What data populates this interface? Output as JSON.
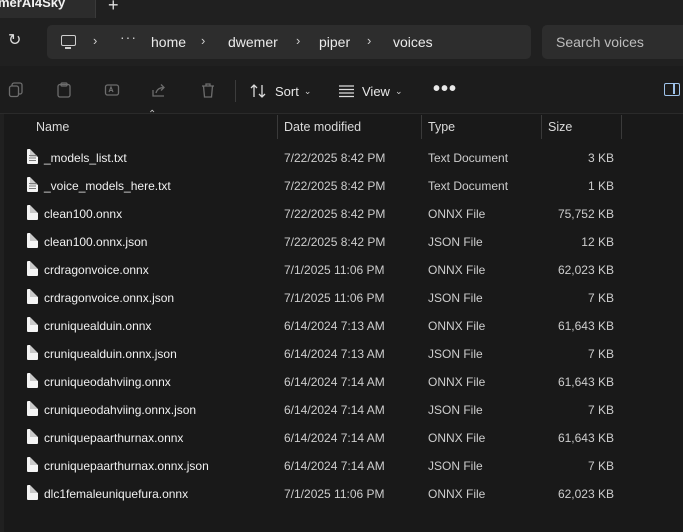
{
  "tab": {
    "title": "merAI4Sky",
    "new_tab_icon": "plus-icon"
  },
  "address": {
    "ellipsis": "···",
    "breadcrumbs": [
      "home",
      "dwemer",
      "piper",
      "voices"
    ]
  },
  "search": {
    "placeholder": "Search voices"
  },
  "toolbar": {
    "sort_label": "Sort",
    "view_label": "View",
    "more_label": "•••"
  },
  "columns": {
    "name": "Name",
    "date": "Date modified",
    "type": "Type",
    "size": "Size"
  },
  "files": [
    {
      "name": "_models_list.txt",
      "date": "7/22/2025 8:42 PM",
      "type": "Text Document",
      "size": "3 KB",
      "icon": "text-file-icon"
    },
    {
      "name": "_voice_models_here.txt",
      "date": "7/22/2025 8:42 PM",
      "type": "Text Document",
      "size": "1 KB",
      "icon": "text-file-icon"
    },
    {
      "name": "clean100.onnx",
      "date": "7/22/2025 8:42 PM",
      "type": "ONNX File",
      "size": "75,752 KB",
      "icon": "file-icon"
    },
    {
      "name": "clean100.onnx.json",
      "date": "7/22/2025 8:42 PM",
      "type": "JSON File",
      "size": "12 KB",
      "icon": "file-icon"
    },
    {
      "name": "crdragonvoice.onnx",
      "date": "7/1/2025 11:06 PM",
      "type": "ONNX File",
      "size": "62,023 KB",
      "icon": "file-icon"
    },
    {
      "name": "crdragonvoice.onnx.json",
      "date": "7/1/2025 11:06 PM",
      "type": "JSON File",
      "size": "7 KB",
      "icon": "file-icon"
    },
    {
      "name": "cruniquealduin.onnx",
      "date": "6/14/2024 7:13 AM",
      "type": "ONNX File",
      "size": "61,643 KB",
      "icon": "file-icon"
    },
    {
      "name": "cruniquealduin.onnx.json",
      "date": "6/14/2024 7:13 AM",
      "type": "JSON File",
      "size": "7 KB",
      "icon": "file-icon"
    },
    {
      "name": "cruniqueodahviing.onnx",
      "date": "6/14/2024 7:14 AM",
      "type": "ONNX File",
      "size": "61,643 KB",
      "icon": "file-icon"
    },
    {
      "name": "cruniqueodahviing.onnx.json",
      "date": "6/14/2024 7:14 AM",
      "type": "JSON File",
      "size": "7 KB",
      "icon": "file-icon"
    },
    {
      "name": "cruniquepaarthurnax.onnx",
      "date": "6/14/2024 7:14 AM",
      "type": "ONNX File",
      "size": "61,643 KB",
      "icon": "file-icon"
    },
    {
      "name": "cruniquepaarthurnax.onnx.json",
      "date": "6/14/2024 7:14 AM",
      "type": "JSON File",
      "size": "7 KB",
      "icon": "file-icon"
    },
    {
      "name": "dlc1femaleuniquefura.onnx",
      "date": "7/1/2025 11:06 PM",
      "type": "ONNX File",
      "size": "62,023 KB",
      "icon": "file-icon"
    }
  ],
  "colors": {
    "background": "#191919",
    "chrome": "#202020",
    "field": "#2d2d2d",
    "accent": "#9fc3ea"
  }
}
